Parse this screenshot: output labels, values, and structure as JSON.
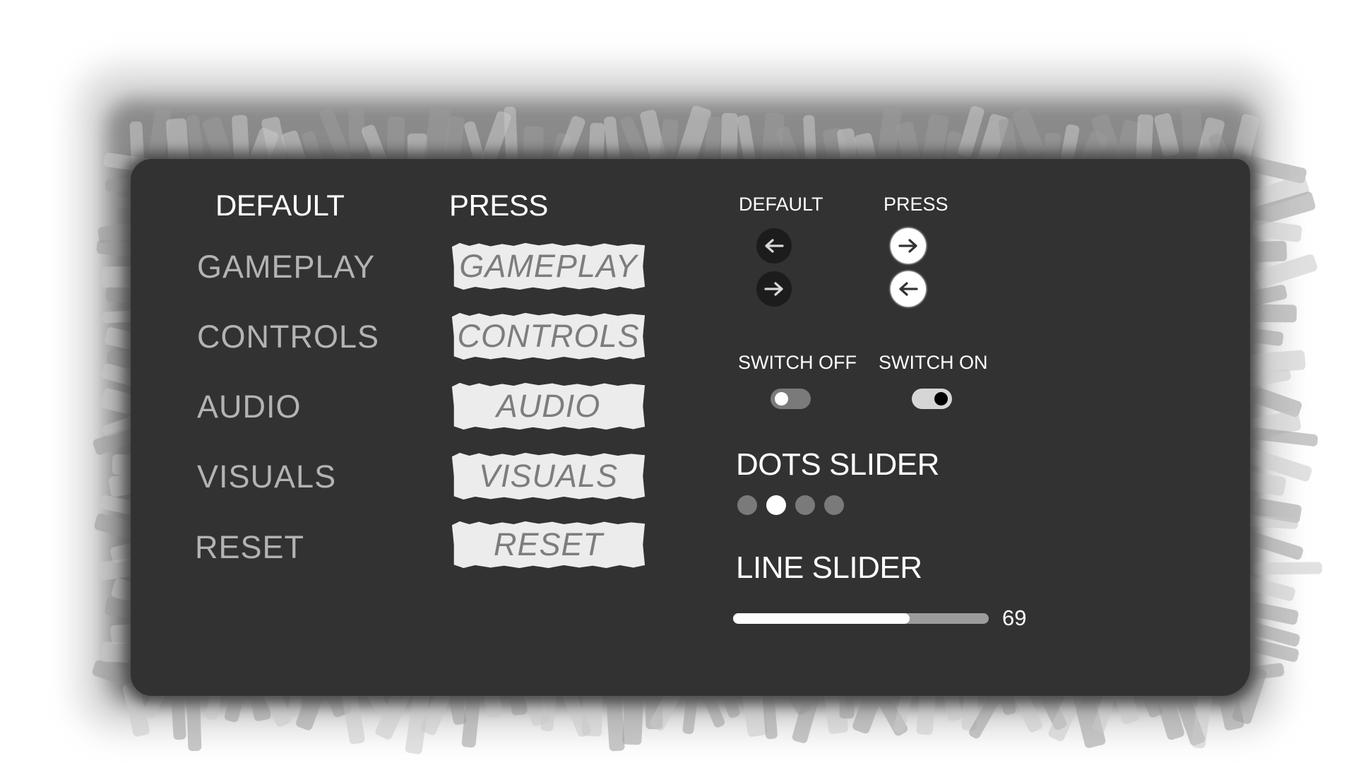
{
  "colors": {
    "panel_bg": "#323232",
    "menu_text": "#b3b3b3",
    "press_bg": "#ececec",
    "press_text": "#7d7d7d",
    "arrow_default_bg": "#1c1c1c",
    "arrow_default_fg": "#d8d8d8",
    "arrow_press_bg": "#ffffff",
    "arrow_press_fg": "#333333",
    "dot_inactive": "#7a7a7a",
    "dot_active": "#ffffff",
    "slider_fill": "#ffffff",
    "slider_track": "#9c9c9c",
    "toggle_off_bg": "#7a7a7a",
    "toggle_off_knob": "#ffffff",
    "toggle_on_bg": "#d6d6d6",
    "toggle_on_knob": "#000000"
  },
  "menu": {
    "default_header": "DEFAULT",
    "press_header": "PRESS",
    "items": [
      {
        "label": "GAMEPLAY"
      },
      {
        "label": "CONTROLS"
      },
      {
        "label": "AUDIO"
      },
      {
        "label": "VISUALS"
      },
      {
        "label": "RESET"
      }
    ]
  },
  "arrows": {
    "default_header": "DEFAULT",
    "press_header": "PRESS",
    "default_buttons": [
      {
        "icon": "arrow-left-icon"
      },
      {
        "icon": "arrow-right-icon"
      }
    ],
    "press_buttons": [
      {
        "icon": "arrow-right-icon"
      },
      {
        "icon": "arrow-left-icon"
      }
    ]
  },
  "switches": {
    "off_label": "SWITCH OFF",
    "on_label": "SWITCH ON",
    "off_state": false,
    "on_state": true
  },
  "dots_slider": {
    "label": "DOTS SLIDER",
    "count": 4,
    "active_index": 1
  },
  "line_slider": {
    "label": "LINE SLIDER",
    "value": 69,
    "value_text": "69",
    "min": 0,
    "max": 100
  }
}
